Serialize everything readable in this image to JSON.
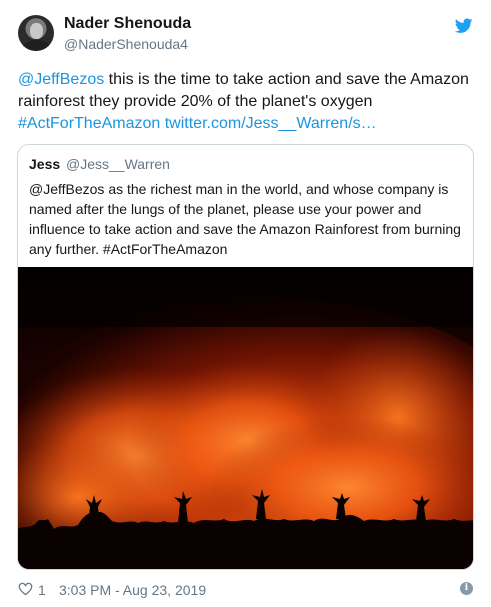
{
  "author": {
    "name": "Nader Shenouda",
    "handle": "@NaderShenouda4"
  },
  "tweet": {
    "line1_mention": "@JeffBezos",
    "line1_text": " this is the time to take action and save the Amazon",
    "line2_text": "rainforest they provide 20% of the planet's oxygen",
    "line3_hashtag": "#ActForTheAmazon",
    "line3_link": "twitter.com/Jess__Warren/s…"
  },
  "quoted": {
    "name": "Jess",
    "handle": "@Jess__Warren",
    "lines": [
      "@JeffBezos as the richest man in the world, and whose company is",
      "named after the lungs of the planet, please use your power and",
      "influence to take action and save the Amazon Rainforest from burning",
      "any further. #ActForTheAmazon"
    ],
    "image_alt": "amazon-rainforest-fire-photo"
  },
  "footer": {
    "likes": "1",
    "timestamp": "3:03 PM - Aug 23, 2019"
  },
  "icons": {
    "brand": "twitter-bird-icon",
    "like": "heart-icon",
    "info": "info-icon"
  },
  "colors": {
    "link": "#1b95e0",
    "brand": "#1da1f2",
    "secondary_text": "#657786",
    "border": "#ccd6dd"
  }
}
